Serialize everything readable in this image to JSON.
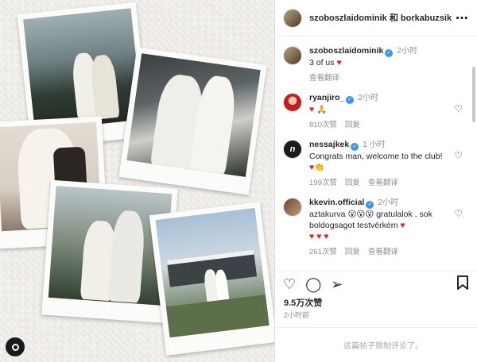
{
  "post": {
    "header_title": "szoboszlaidominik 和 borkabuzsik",
    "more_icon": "more-dots-icon",
    "caption": {
      "username": "szoboszlaidominik",
      "time": "2小时",
      "text": "3 of us",
      "see_translation": "查看翻译"
    },
    "comments": [
      {
        "username": "ryanjiro_",
        "time": "2小时",
        "text": "🙏",
        "likes": "810次赞",
        "reply": "回复",
        "see_translation": ""
      },
      {
        "username": "nessajkek",
        "time": "1 小时",
        "text": "Congrats man, welcome to the club!",
        "likes": "199次赞",
        "reply": "回复",
        "see_translation": "查看翻译"
      },
      {
        "username": "kkevin.official",
        "time": "2小时",
        "text": "aztakurva 😮😮😮 gratulalok , sok boldogsagot testvérkém",
        "likes": "261次赞",
        "reply": "回复",
        "see_translation": "查看翻译"
      }
    ],
    "likes_count": "9.5万次赞",
    "posted_ago": "2小时前",
    "comments_disabled": "这篇帖子限制评论了。"
  },
  "colors": {
    "verified": "#3897f0",
    "heart": "#ed1c24",
    "muted": "#8e8e8e"
  }
}
